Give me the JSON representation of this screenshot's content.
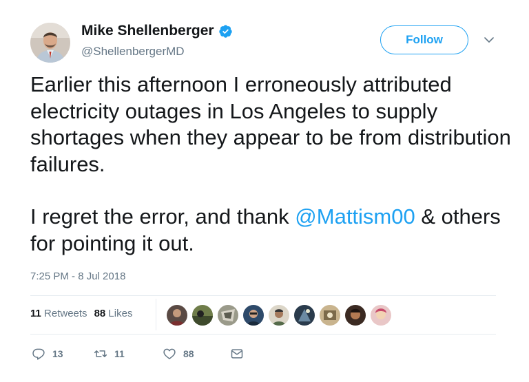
{
  "author": {
    "name": "Mike Shellenberger",
    "handle": "@ShellenbergerMD",
    "verified": true
  },
  "follow_label": "Follow",
  "tweet": {
    "paragraph1": "Earlier this afternoon I erroneously attributed electricity outages in Los Angeles to supply shortages when they appear to be from distribution failures.",
    "paragraph2_before": "I regret the error, and thank ",
    "mention": "@Mattism00",
    "paragraph2_after": " & others for pointing it out."
  },
  "timestamp": "7:25 PM - 8 Jul 2018",
  "stats": {
    "retweets_count": "11",
    "retweets_label": "Retweets",
    "likes_count": "88",
    "likes_label": "Likes"
  },
  "likers_count": 9,
  "actions": {
    "reply_count": "13",
    "retweet_count": "11",
    "like_count": "88"
  },
  "colors": {
    "accent": "#1da1f2",
    "text": "#14171a",
    "secondary": "#657786",
    "divider": "#e6ecf0"
  },
  "icons": [
    "verified-badge-icon",
    "chevron-down-icon",
    "reply-icon",
    "retweet-icon",
    "heart-icon",
    "envelope-icon"
  ]
}
